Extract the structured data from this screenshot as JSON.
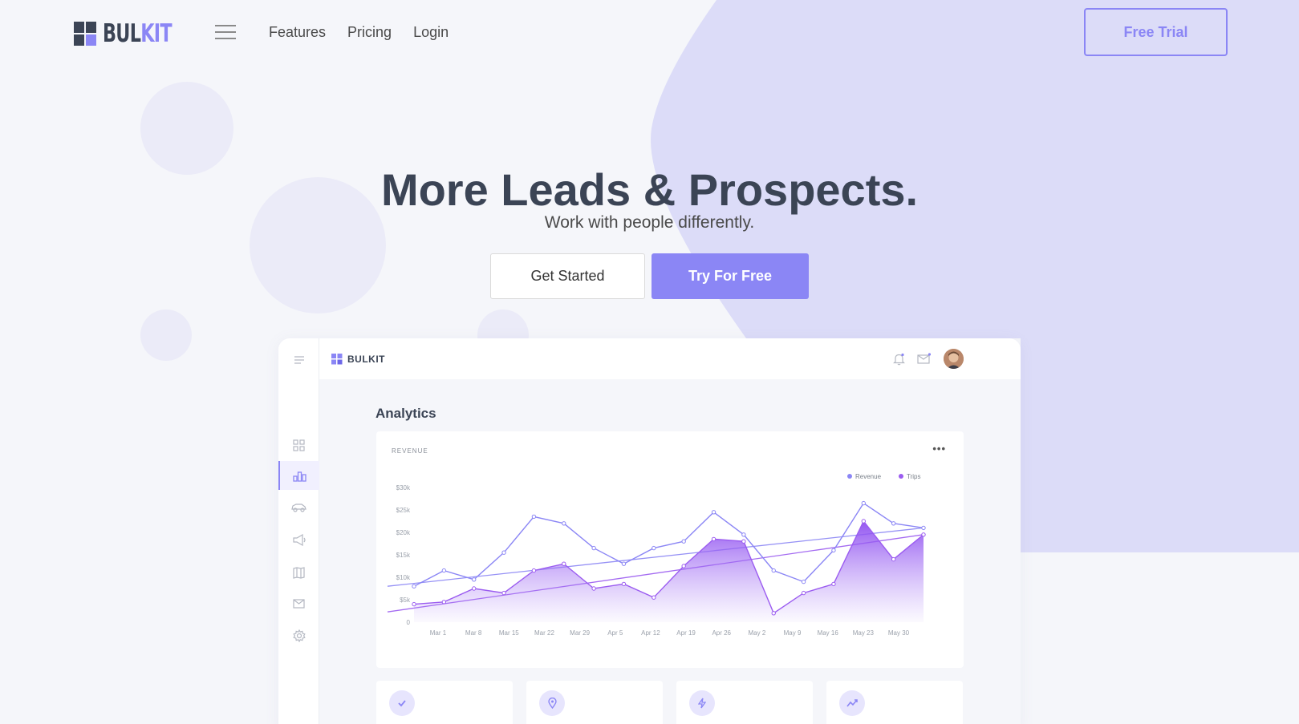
{
  "brand": {
    "logo_part1": "BUL",
    "logo_part2": "KIT",
    "accent": "#8b86f5",
    "dark": "#3b4455",
    "shape_color": "#dcdcf8"
  },
  "nav": {
    "menu_icon": "hamburger-icon",
    "links": [
      "Features",
      "Pricing",
      "Login"
    ],
    "cta": "Free Trial"
  },
  "hero": {
    "title": "More Leads & Prospects.",
    "subtitle": "Work with people differently.",
    "primary_button": "Get Started",
    "secondary_button": "Try For Free"
  },
  "dashboard": {
    "logo_text": "BULKIT",
    "section_title": "Analytics",
    "sidebar_icons": [
      "menu-icon",
      "grid-icon",
      "bar-chart-icon",
      "car-icon",
      "megaphone-icon",
      "map-icon",
      "mail-icon",
      "settings-icon"
    ],
    "top_icons": [
      "bell-icon",
      "mail-icon",
      "avatar"
    ],
    "chart_card": {
      "label": "REVENUE",
      "menu": "•••"
    },
    "stat_cards": [
      {
        "icon": "check-icon"
      },
      {
        "icon": "location-pin-icon"
      },
      {
        "icon": "bolt-icon"
      },
      {
        "icon": "trend-icon"
      }
    ]
  },
  "chart_data": {
    "type": "line",
    "title": "REVENUE",
    "legend": [
      "Revenue",
      "Trips"
    ],
    "legend_position": "top-right",
    "y_ticks": [
      "$30k",
      "$25k",
      "$20k",
      "$15k",
      "$10k",
      "$5k",
      "0"
    ],
    "ylim": [
      0,
      30000
    ],
    "x_tick_labels": [
      "Mar 1",
      "Mar 8",
      "Mar 15",
      "Mar 22",
      "Mar 29",
      "Apr 5",
      "Apr 12",
      "Apr 19",
      "Apr 26",
      "May 2",
      "May 9",
      "May 16",
      "May 23",
      "May 30"
    ],
    "series": [
      {
        "name": "Revenue",
        "color": "#8b86f5",
        "style": "line",
        "values": [
          8000,
          11500,
          9500,
          15500,
          23500,
          22000,
          16500,
          13000,
          16500,
          18000,
          24500,
          19500,
          11500,
          9000,
          16000,
          26500,
          22000,
          21000
        ]
      },
      {
        "name": "Trips",
        "color": "#9b5cf0",
        "style": "area",
        "values": [
          4000,
          4500,
          7500,
          6500,
          11500,
          13000,
          7500,
          8500,
          5500,
          12500,
          18500,
          18000,
          2000,
          6500,
          8500,
          22500,
          14000,
          19500
        ]
      }
    ],
    "trendlines": [
      {
        "series": "Revenue",
        "from": 8000,
        "to": 21000
      },
      {
        "series": "Trips",
        "from": 3000,
        "to": 19500
      }
    ],
    "grid": false
  }
}
